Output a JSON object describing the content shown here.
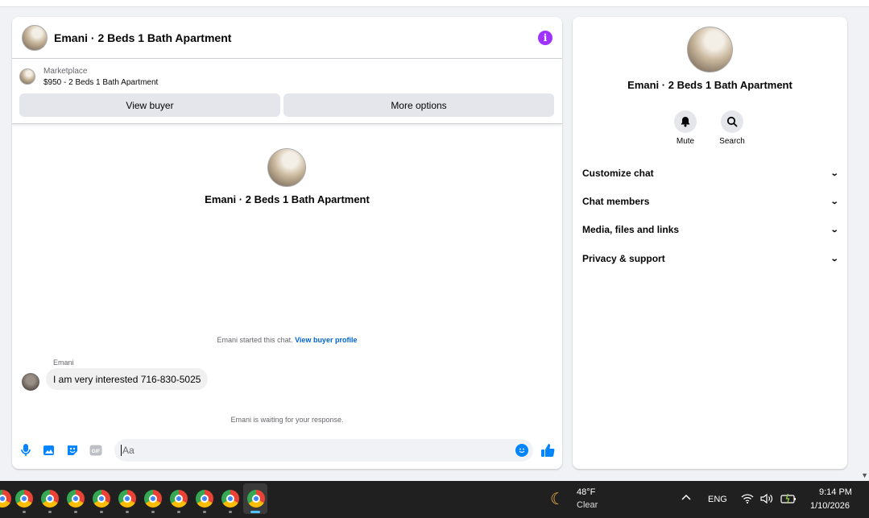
{
  "chat": {
    "title": "Emani · 2 Beds 1 Bath Apartment",
    "info_icon": "i",
    "listing": {
      "label": "Marketplace",
      "price_title": "$950 - 2 Beds 1 Bath Apartment"
    },
    "buttons": {
      "view_buyer": "View buyer",
      "more_options": "More options"
    },
    "intro_title": "Emani · 2 Beds 1 Bath Apartment",
    "started_text": "Emani started this chat.",
    "started_link": "View buyer profile",
    "messages": [
      {
        "sender": "Emani",
        "text": "I am very interested 716-830-5025"
      }
    ],
    "waiting_text": "Emani is waiting for your response.",
    "composer": {
      "placeholder": "Aa",
      "icons": [
        "microphone-icon",
        "photo-icon",
        "sticker-icon",
        "gif-icon",
        "emoji-icon",
        "thumbs-up-icon"
      ],
      "gif_label": "GIF"
    }
  },
  "sidebar": {
    "title": "Emani · 2 Beds 1 Bath Apartment",
    "actions": [
      {
        "label": "Mute",
        "icon": "bell-icon"
      },
      {
        "label": "Search",
        "icon": "search-icon"
      }
    ],
    "menu": [
      "Customize chat",
      "Chat members",
      "Media, files and links",
      "Privacy & support"
    ]
  },
  "taskbar": {
    "app_icon": "chrome-icon",
    "app_count": 10,
    "weather": {
      "temp": "48°F",
      "desc": "Clear"
    },
    "language": "ENG",
    "time": "9:14 PM",
    "date": "1/10/2026"
  },
  "colors": {
    "accent": "#0084ff",
    "info": "#a033ff",
    "link": "#0064d1",
    "taskbar": "#202020"
  }
}
